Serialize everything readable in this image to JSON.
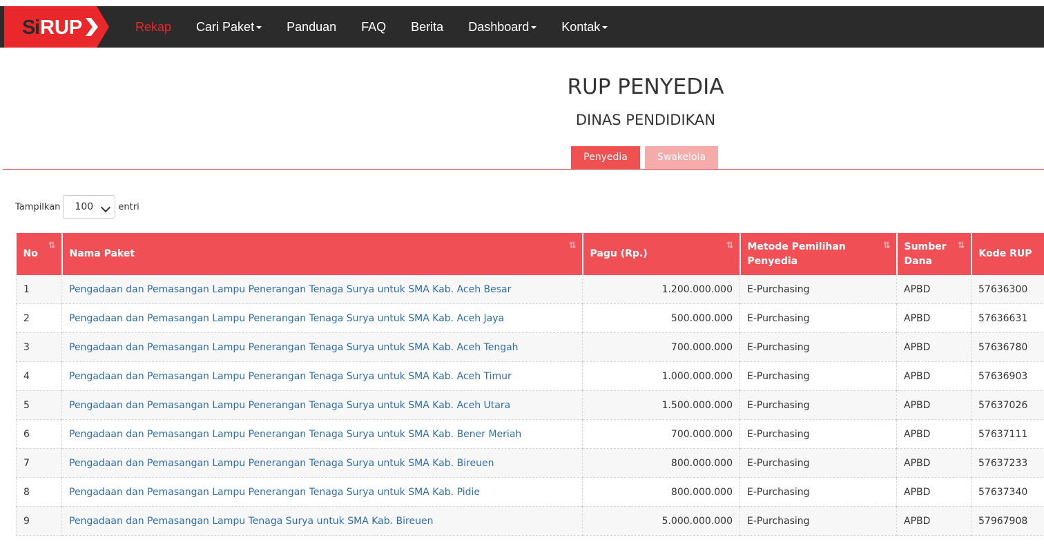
{
  "nav": {
    "logo_text": "SiRUP",
    "items": [
      {
        "label": "Rekap",
        "active": true,
        "dropdown": false
      },
      {
        "label": "Cari Paket",
        "active": false,
        "dropdown": true
      },
      {
        "label": "Panduan",
        "active": false,
        "dropdown": false
      },
      {
        "label": "FAQ",
        "active": false,
        "dropdown": false
      },
      {
        "label": "Berita",
        "active": false,
        "dropdown": false
      },
      {
        "label": "Dashboard",
        "active": false,
        "dropdown": true
      },
      {
        "label": "Kontak",
        "active": false,
        "dropdown": true
      }
    ]
  },
  "page": {
    "title": "RUP PENYEDIA",
    "subtitle": "DINAS PENDIDIKAN",
    "tabs": [
      "Penyedia",
      "Swakelola"
    ]
  },
  "length_menu": {
    "prefix": "Tampilkan",
    "value": "100",
    "suffix": "entri"
  },
  "table": {
    "columns": [
      "No",
      "Nama Paket",
      "Pagu (Rp.)",
      "Metode Pemilihan Penyedia",
      "Sumber Dana",
      "Kode RUP"
    ],
    "rows": [
      [
        "1",
        "Pengadaan dan Pemasangan Lampu Penerangan Tenaga Surya untuk SMA Kab. Aceh Besar",
        "1.200.000.000",
        "E-Purchasing",
        "APBD",
        "57636300"
      ],
      [
        "2",
        "Pengadaan dan Pemasangan Lampu Penerangan Tenaga Surya untuk SMA Kab. Aceh Jaya",
        "500.000.000",
        "E-Purchasing",
        "APBD",
        "57636631"
      ],
      [
        "3",
        "Pengadaan dan Pemasangan Lampu Penerangan Tenaga Surya untuk SMA Kab. Aceh Tengah",
        "700.000.000",
        "E-Purchasing",
        "APBD",
        "57636780"
      ],
      [
        "4",
        "Pengadaan dan Pemasangan Lampu Penerangan Tenaga Surya untuk SMA Kab. Aceh Timur",
        "1.000.000.000",
        "E-Purchasing",
        "APBD",
        "57636903"
      ],
      [
        "5",
        "Pengadaan dan Pemasangan Lampu Penerangan Tenaga Surya untuk SMA Kab. Aceh Utara",
        "1.500.000.000",
        "E-Purchasing",
        "APBD",
        "57637026"
      ],
      [
        "6",
        "Pengadaan dan Pemasangan Lampu Penerangan Tenaga Surya untuk SMA Kab. Bener Meriah",
        "700.000.000",
        "E-Purchasing",
        "APBD",
        "57637111"
      ],
      [
        "7",
        "Pengadaan dan Pemasangan Lampu Penerangan Tenaga Surya untuk SMA Kab. Bireuen",
        "800.000.000",
        "E-Purchasing",
        "APBD",
        "57637233"
      ],
      [
        "8",
        "Pengadaan dan Pemasangan Lampu Penerangan Tenaga Surya untuk SMA Kab. Pidie",
        "800.000.000",
        "E-Purchasing",
        "APBD",
        "57637340"
      ],
      [
        "9",
        "Pengadaan dan Pemasangan Lampu Tenaga Surya untuk SMA Kab. Bireuen",
        "5.000.000.000",
        "E-Purchasing",
        "APBD",
        "57967908"
      ]
    ]
  },
  "colors": {
    "navbar": "#2b2b2b",
    "accent": "#e8282b",
    "table_header": "#f05055",
    "tab_active": "#ef5050",
    "tab_inactive": "#f6abab",
    "link": "#2e6ca6"
  }
}
